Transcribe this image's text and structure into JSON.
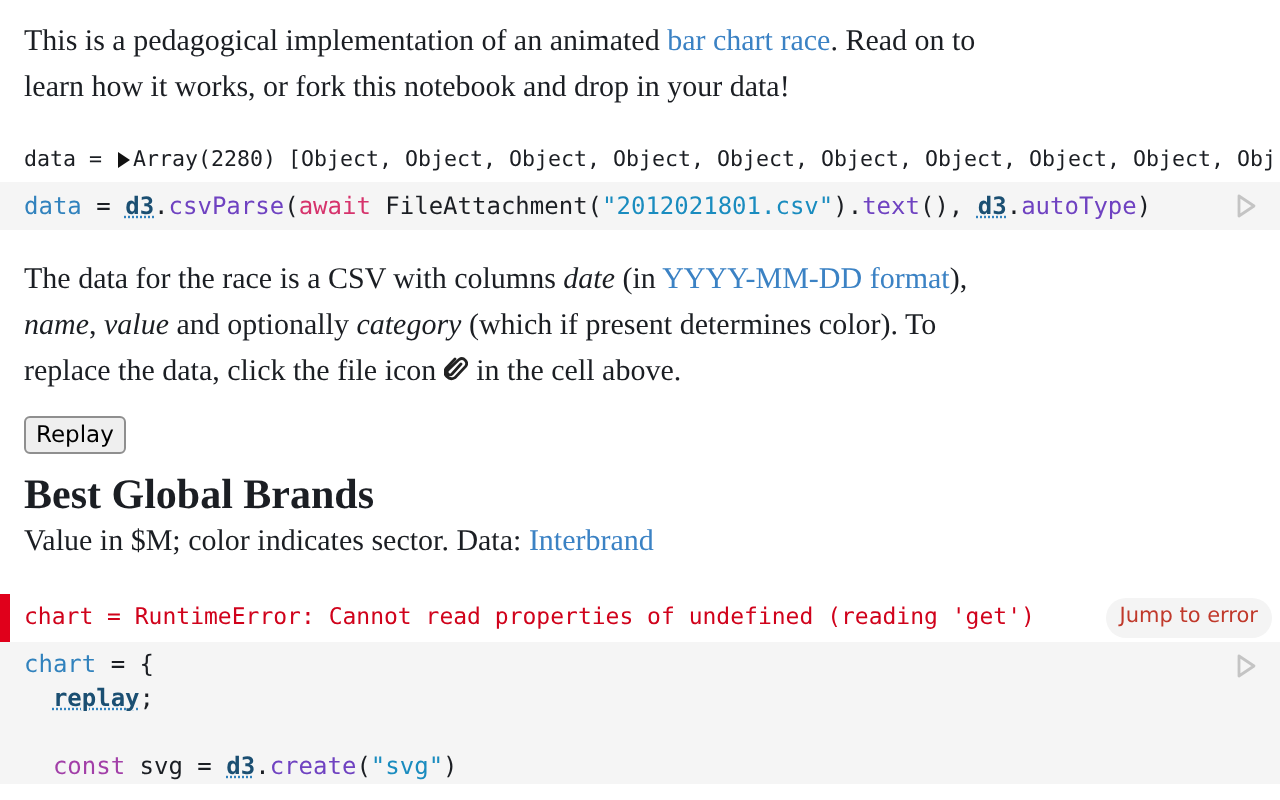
{
  "cells": [
    {
      "kind": "paragraph",
      "segments": [
        {
          "kind": "text",
          "text": "This is a pedagogical implementation of an animated "
        },
        {
          "kind": "link",
          "text": "bar chart race"
        },
        {
          "kind": "text",
          "text": ". Read on to learn how it works, or fork this notebook and drop in your data!"
        }
      ]
    },
    {
      "kind": "output",
      "name": "data =",
      "expanded": false,
      "summary": "Array(2280)",
      "preview": "[Object, Object, Object, Object, Object, Object, Object, Object, Object, Obj"
    },
    {
      "kind": "code",
      "lines": [
        {
          "tokens": [
            {
              "kind": "def",
              "t": "data"
            },
            {
              "kind": "plain",
              "t": " = "
            },
            {
              "kind": "global",
              "t": "d3"
            },
            {
              "kind": "plain",
              "t": "."
            },
            {
              "kind": "method",
              "t": "csvParse"
            },
            {
              "kind": "plain",
              "t": "("
            },
            {
              "kind": "keyword",
              "t": "await"
            },
            {
              "kind": "plain",
              "t": " FileAttachment("
            },
            {
              "kind": "string",
              "t": "\"2012021801.csv\""
            },
            {
              "kind": "plain",
              "t": ")."
            },
            {
              "kind": "method",
              "t": "text"
            },
            {
              "kind": "plain",
              "t": "(), "
            },
            {
              "kind": "global",
              "t": "d3"
            },
            {
              "kind": "plain",
              "t": "."
            },
            {
              "kind": "method",
              "t": "autoType"
            },
            {
              "kind": "plain",
              "t": ")"
            }
          ]
        }
      ]
    },
    {
      "kind": "paragraph",
      "segments": [
        {
          "kind": "text",
          "text": "The data for the race is a CSV with columns *date* (in "
        },
        {
          "kind": "link",
          "text": "YYYY-MM-DD format"
        },
        {
          "kind": "text",
          "text": "), *name*, *value* and optionally *category* (which if present determines color). To replace the data, click the file icon"
        },
        {
          "kind": "icon"
        },
        {
          "kind": "text",
          "text": "in the cell above."
        }
      ]
    },
    {
      "kind": "button",
      "label": "Replay"
    },
    {
      "kind": "heading",
      "text": "Best Global Brands"
    },
    {
      "kind": "paragraph",
      "segments": [
        {
          "kind": "text",
          "text": "Value in $M; color indicates sector. Data: "
        },
        {
          "kind": "link",
          "text": "Interbrand"
        }
      ]
    },
    {
      "kind": "error",
      "text": "chart = RuntimeError: Cannot read properties of undefined (reading 'get')",
      "action": "Jump to error"
    },
    {
      "kind": "code",
      "lines": [
        {
          "tokens": [
            {
              "kind": "def",
              "t": "chart"
            },
            {
              "kind": "plain",
              "t": " = {"
            }
          ],
          "children": [
            {
              "tokens": [
                {
                  "kind": "global",
                  "t": "replay"
                },
                {
                  "kind": "plain",
                  "t": ";"
                }
              ]
            },
            {
              "blank_before": true,
              "tokens": [
                {
                  "kind": "keyword2",
                  "t": "const"
                },
                {
                  "kind": "plain",
                  "t": " svg = "
                },
                {
                  "kind": "global",
                  "t": "d3"
                },
                {
                  "kind": "plain",
                  "t": "."
                },
                {
                  "kind": "method",
                  "t": "create"
                },
                {
                  "kind": "plain",
                  "t": "("
                },
                {
                  "kind": "string",
                  "t": "\"svg\""
                },
                {
                  "kind": "plain",
                  "t": ")"
                }
              ]
            }
          ]
        }
      ]
    }
  ]
}
